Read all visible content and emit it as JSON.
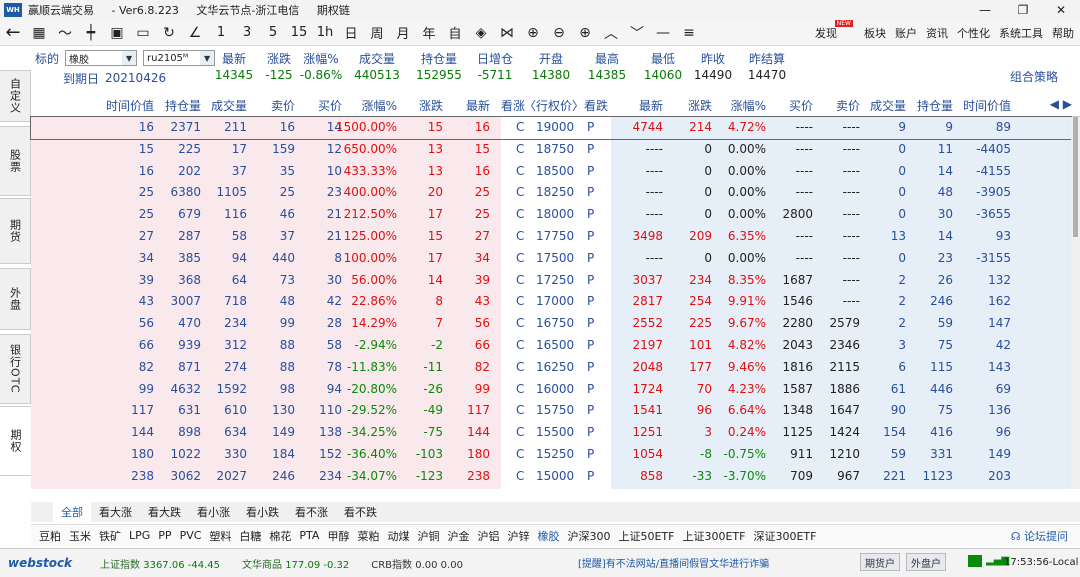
{
  "titlebar": {
    "app_name": "赢顺云端交易",
    "version": "- Ver6.8.223",
    "node": "文华云节点-浙江电信",
    "panel": "期权链",
    "min": "—",
    "restore": "❐",
    "close": "✕"
  },
  "toolbar": {
    "periods": [
      "1",
      "3",
      "5",
      "15",
      "1h",
      "日",
      "周",
      "月",
      "年",
      "自"
    ],
    "menu": [
      "发现",
      "板块",
      "账户",
      "资讯",
      "个性化",
      "系统工具",
      "帮助"
    ],
    "new_badge": "NEW"
  },
  "lefttabs": [
    "自定义",
    "股票",
    "期货",
    "外盘",
    "银行OTC",
    "期权"
  ],
  "info": {
    "underlying_label": "标的",
    "underlying_value": "橡胶",
    "contract_value": "ru2105ᴹ",
    "expiry_label": "到期日",
    "expiry_value": "20210426",
    "combo": "组合策略",
    "quote_headers": [
      "最新",
      "涨跌",
      "涨幅%",
      "成交量",
      "持仓量",
      "日增仓",
      "开盘",
      "最高",
      "最低",
      "昨收",
      "昨结算"
    ],
    "quote_values": [
      "14345",
      "-125",
      "-0.86%",
      "440513",
      "152955",
      "-5711",
      "14380",
      "14385",
      "14060",
      "14490",
      "14470"
    ]
  },
  "columns": {
    "call": [
      "时间价值",
      "持仓量",
      "成交量",
      "卖价",
      "买价",
      "涨幅%",
      "涨跌",
      "最新",
      "看涨"
    ],
    "strike": "〈行权价〉",
    "put": [
      "看跌",
      "最新",
      "涨跌",
      "涨幅%",
      "买价",
      "卖价",
      "成交量",
      "持仓量",
      "时间价值"
    ],
    "scroll": "◀ ▶"
  },
  "rows": [
    {
      "c": [
        "16",
        "2371",
        "211",
        "16",
        "14",
        "1500.00%",
        "15",
        "16"
      ],
      "k": "19000",
      "p": [
        "4744",
        "214",
        "4.72%",
        "----",
        "----",
        "9",
        "9",
        "89"
      ]
    },
    {
      "c": [
        "15",
        "225",
        "17",
        "159",
        "12",
        "650.00%",
        "13",
        "15"
      ],
      "k": "18750",
      "p": [
        "----",
        "0",
        "0.00%",
        "----",
        "----",
        "0",
        "11",
        "-4405"
      ]
    },
    {
      "c": [
        "16",
        "202",
        "37",
        "35",
        "10",
        "433.33%",
        "13",
        "16"
      ],
      "k": "18500",
      "p": [
        "----",
        "0",
        "0.00%",
        "----",
        "----",
        "0",
        "14",
        "-4155"
      ]
    },
    {
      "c": [
        "25",
        "6380",
        "1105",
        "25",
        "23",
        "400.00%",
        "20",
        "25"
      ],
      "k": "18250",
      "p": [
        "----",
        "0",
        "0.00%",
        "----",
        "----",
        "0",
        "48",
        "-3905"
      ]
    },
    {
      "c": [
        "25",
        "679",
        "116",
        "46",
        "21",
        "212.50%",
        "17",
        "25"
      ],
      "k": "18000",
      "p": [
        "----",
        "0",
        "0.00%",
        "2800",
        "----",
        "0",
        "30",
        "-3655"
      ]
    },
    {
      "c": [
        "27",
        "287",
        "58",
        "37",
        "21",
        "125.00%",
        "15",
        "27"
      ],
      "k": "17750",
      "p": [
        "3498",
        "209",
        "6.35%",
        "----",
        "----",
        "13",
        "14",
        "93"
      ]
    },
    {
      "c": [
        "34",
        "385",
        "94",
        "440",
        "8",
        "100.00%",
        "17",
        "34"
      ],
      "k": "17500",
      "p": [
        "----",
        "0",
        "0.00%",
        "----",
        "----",
        "0",
        "23",
        "-3155"
      ]
    },
    {
      "c": [
        "39",
        "368",
        "64",
        "73",
        "30",
        "56.00%",
        "14",
        "39"
      ],
      "k": "17250",
      "p": [
        "3037",
        "234",
        "8.35%",
        "1687",
        "----",
        "2",
        "26",
        "132"
      ]
    },
    {
      "c": [
        "43",
        "3007",
        "718",
        "48",
        "42",
        "22.86%",
        "8",
        "43"
      ],
      "k": "17000",
      "p": [
        "2817",
        "254",
        "9.91%",
        "1546",
        "----",
        "2",
        "246",
        "162"
      ]
    },
    {
      "c": [
        "56",
        "470",
        "234",
        "99",
        "28",
        "14.29%",
        "7",
        "56"
      ],
      "k": "16750",
      "p": [
        "2552",
        "225",
        "9.67%",
        "2280",
        "2579",
        "2",
        "59",
        "147"
      ]
    },
    {
      "c": [
        "66",
        "939",
        "312",
        "88",
        "58",
        "-2.94%",
        "-2",
        "66"
      ],
      "k": "16500",
      "p": [
        "2197",
        "101",
        "4.82%",
        "2043",
        "2346",
        "3",
        "75",
        "42"
      ]
    },
    {
      "c": [
        "82",
        "871",
        "274",
        "88",
        "78",
        "-11.83%",
        "-11",
        "82"
      ],
      "k": "16250",
      "p": [
        "2048",
        "177",
        "9.46%",
        "1816",
        "2115",
        "6",
        "115",
        "143"
      ]
    },
    {
      "c": [
        "99",
        "4632",
        "1592",
        "98",
        "94",
        "-20.80%",
        "-26",
        "99"
      ],
      "k": "16000",
      "p": [
        "1724",
        "70",
        "4.23%",
        "1587",
        "1886",
        "61",
        "446",
        "69"
      ]
    },
    {
      "c": [
        "117",
        "631",
        "610",
        "130",
        "110",
        "-29.52%",
        "-49",
        "117"
      ],
      "k": "15750",
      "p": [
        "1541",
        "96",
        "6.64%",
        "1348",
        "1647",
        "90",
        "75",
        "136"
      ]
    },
    {
      "c": [
        "144",
        "898",
        "634",
        "149",
        "138",
        "-34.25%",
        "-75",
        "144"
      ],
      "k": "15500",
      "p": [
        "1251",
        "3",
        "0.24%",
        "1125",
        "1424",
        "154",
        "416",
        "96"
      ]
    },
    {
      "c": [
        "180",
        "1022",
        "330",
        "184",
        "152",
        "-36.40%",
        "-103",
        "180"
      ],
      "k": "15250",
      "p": [
        "1054",
        "-8",
        "-0.75%",
        "911",
        "1210",
        "59",
        "331",
        "149"
      ]
    },
    {
      "c": [
        "238",
        "3062",
        "2027",
        "246",
        "234",
        "-34.07%",
        "-123",
        "238"
      ],
      "k": "15000",
      "p": [
        "858",
        "-33",
        "-3.70%",
        "709",
        "967",
        "221",
        "1123",
        "203"
      ]
    }
  ],
  "filters": [
    "全部",
    "看大涨",
    "看大跌",
    "看小涨",
    "看小跌",
    "看不涨",
    "看不跌"
  ],
  "commodities": [
    "豆粕",
    "玉米",
    "铁矿",
    "LPG",
    "PP",
    "PVC",
    "塑料",
    "白糖",
    "棉花",
    "PTA",
    "甲醇",
    "菜粕",
    "动煤",
    "沪铜",
    "沪金",
    "沪铝",
    "沪锌",
    "橡胶",
    "沪深300",
    "上证50ETF",
    "上证300ETF",
    "深证300ETF"
  ],
  "active_commodity": "橡胶",
  "forum": "论坛提问",
  "status": {
    "brand": "webstock",
    "idx1_name": "上证指数",
    "idx1_val": "3367.06 -44.45",
    "idx2_name": "文华商品",
    "idx2_val": "177.09 -0.32",
    "idx3_name": "CRB指数",
    "idx3_val": "0.00 0.00",
    "notice": "[提醒]有不法网站/直播间假冒文华进行诈骗",
    "btn1": "期货户",
    "btn2": "外盘户",
    "clock": "17:53:56-Local"
  }
}
